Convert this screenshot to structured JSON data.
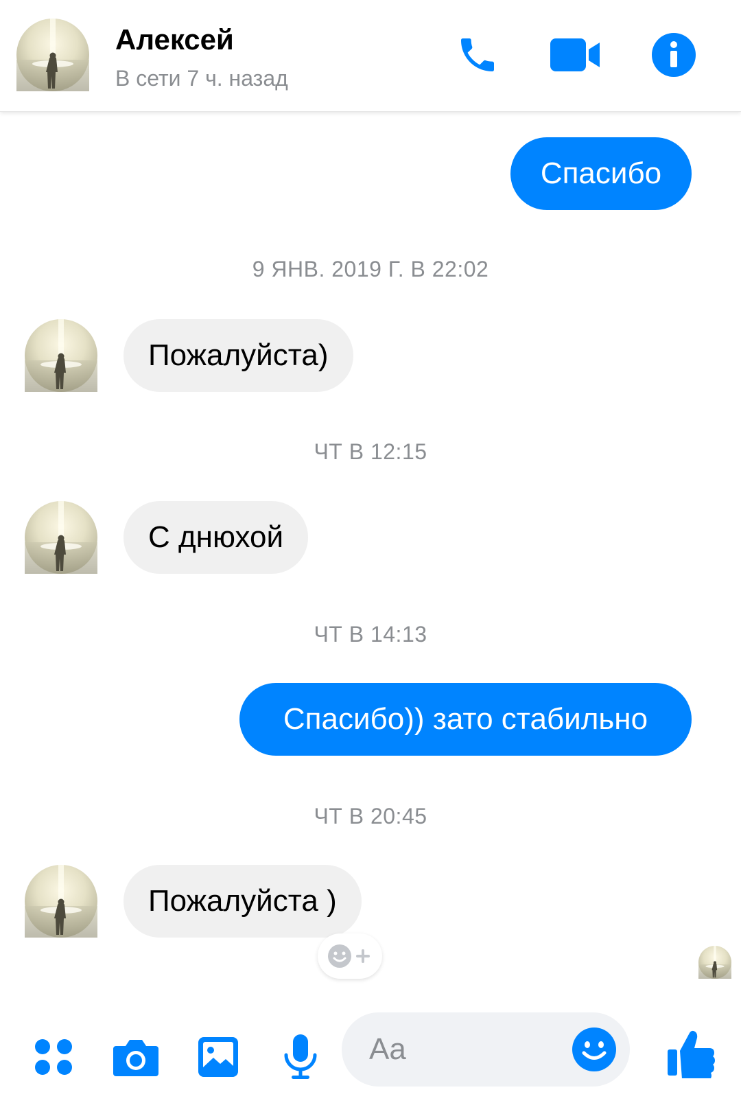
{
  "colors": {
    "accent": "#0084ff",
    "incoming_bubble": "#f0f0f0",
    "muted_text": "#8a8d91",
    "input_background": "#f0f2f5"
  },
  "header": {
    "name": "Алексей",
    "status": "В сети 7 ч. назад",
    "icons": [
      "phone-icon",
      "video-camera-icon",
      "info-icon"
    ]
  },
  "messages": [
    {
      "type": "message",
      "direction": "out",
      "text": "Спасибо"
    },
    {
      "type": "timestamp",
      "text": "9 ЯНВ. 2019 Г. В 22:02"
    },
    {
      "type": "message",
      "direction": "in",
      "text": "Пожалуйста)"
    },
    {
      "type": "timestamp",
      "text": "ЧТ В 12:15"
    },
    {
      "type": "message",
      "direction": "in",
      "text": "С днюхой"
    },
    {
      "type": "timestamp",
      "text": "ЧТ В 14:13"
    },
    {
      "type": "message",
      "direction": "out",
      "text": "Спасибо)) зато стабильно"
    },
    {
      "type": "timestamp",
      "text": "ЧТ В 20:45"
    },
    {
      "type": "message",
      "direction": "in",
      "text": "Пожалуйста )"
    }
  ],
  "composer": {
    "placeholder": "Aa",
    "icons": [
      "apps-icon",
      "camera-icon",
      "gallery-icon",
      "microphone-icon",
      "emoji-icon",
      "thumbs-up-icon"
    ]
  },
  "reaction": {
    "icon": "add-reaction-icon"
  }
}
